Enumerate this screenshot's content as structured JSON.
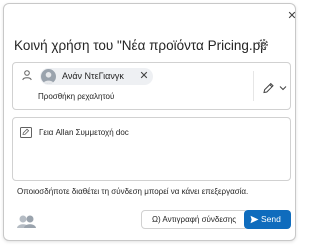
{
  "dialog": {
    "title": "Κοινή χρήση του \"Νέα προϊόντα Pricing.pptx\"",
    "close_glyph": "✕"
  },
  "recipients": {
    "chip_name": "Ανάν ΝτεΓιανγκ",
    "chip_remove_glyph": "✕",
    "add_label": "Προσθήκη ρεχαλητού"
  },
  "message": {
    "text": "Γεια Allan Συμμετοχή doc"
  },
  "info": {
    "text": "Οποιοσδήποτε διαθέτει τη σύνδεση μπορεί να κάνει επεξεργασία."
  },
  "footer": {
    "copy_label": "Ω) Αντιγραφή σύνδεσης",
    "send_label": "Send"
  },
  "colors": {
    "accent": "#0f6cbd",
    "border": "#d1d1d1"
  },
  "icons": [
    "close-icon",
    "gear-icon",
    "person-icon",
    "pencil-icon",
    "chevron-down-icon",
    "message-icon",
    "people-icon",
    "send-icon"
  ]
}
